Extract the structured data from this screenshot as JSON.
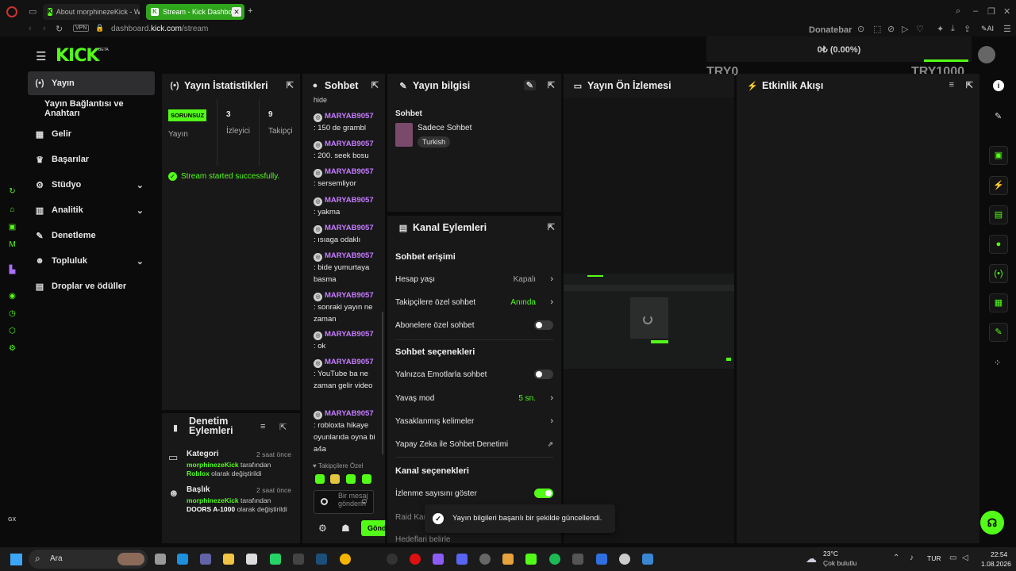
{
  "browser": {
    "tabs": [
      {
        "label": "About morphinezeKick - W",
        "active": false
      },
      {
        "label": "Stream - Kick Dashboa",
        "active": true
      }
    ],
    "new_tab": "+",
    "vpn": "VPN",
    "url_host": "dashboard.",
    "url_domain": "kick.com",
    "url_path": "/stream",
    "extension_label": "Donatebar",
    "ai_label": "AI"
  },
  "overlay": {
    "amount": "0₺ (0.00%)",
    "left_label": "TRY0",
    "right_label": "TRY1000"
  },
  "logo": "KICK",
  "logo_badge": "BETA",
  "sidebar": {
    "items": [
      {
        "label": "Yayın",
        "active": true,
        "icon": "broadcast-icon",
        "glyph": "(•)"
      },
      {
        "label": "Yayın Bağlantısı ve Anahtarı",
        "active": false,
        "icon": "",
        "glyph": ""
      },
      {
        "label": "Gelir",
        "active": false,
        "icon": "chart-icon",
        "glyph": "▦"
      },
      {
        "label": "Başarılar",
        "active": false,
        "icon": "trophy-icon",
        "glyph": "🏆"
      },
      {
        "label": "Stüdyo",
        "active": false,
        "icon": "studio-icon",
        "glyph": "⚙",
        "chevron": true
      },
      {
        "label": "Analitik",
        "active": false,
        "icon": "analytics-icon",
        "glyph": "▥",
        "chevron": true
      },
      {
        "label": "Denetleme",
        "active": false,
        "icon": "wrench-icon",
        "glyph": "🔧"
      },
      {
        "label": "Topluluk",
        "active": false,
        "icon": "community-icon",
        "glyph": "👥",
        "chevron": true
      },
      {
        "label": "Droplar ve ödüller",
        "active": false,
        "icon": "drops-icon",
        "glyph": "▤"
      }
    ]
  },
  "stats": {
    "title": "Yayın İstatistikleri",
    "status_badge": "SORUNSUZ",
    "status_caption": "Yayın",
    "viewers_value": "3",
    "viewers_label": "İzleyici",
    "followers_value": "9",
    "followers_label": "Takipçi",
    "notice": "Stream started successfully."
  },
  "moderation": {
    "title_line1": "Denetim",
    "title_line2": "Eylemleri",
    "items": [
      {
        "title": "Kategori",
        "time": "2 saat önce",
        "user": "morphinezeKick",
        "by": " tarafından",
        "value": "Roblox",
        "suffix": " olarak değiştirildi"
      },
      {
        "title": "Başlık",
        "time": "2 saat önce",
        "user": "morphinezeKick",
        "by": " tarafından",
        "value": "DOORS A-1000",
        "suffix": " olarak değiştirildi"
      }
    ]
  },
  "chat": {
    "title": "Sohbet",
    "top_cut": "hide",
    "messages": [
      {
        "user": "MARYAB9057",
        "text": ": 150 de grambl"
      },
      {
        "user": "MARYAB9057",
        "text": ": 200. seek bosu"
      },
      {
        "user": "MARYAB9057",
        "text": ": sersemliyor"
      },
      {
        "user": "MARYAB9057",
        "text": ": yakma"
      },
      {
        "user": "MARYAB9057",
        "text": ": ısıaga odaklı"
      },
      {
        "user": "MARYAB9057",
        "text": ": bide yumurtaya basma"
      },
      {
        "user": "MARYAB9057",
        "text": ": sonraki yayın ne zaman"
      },
      {
        "user": "MARYAB9057",
        "text": ": ok"
      },
      {
        "user": "MARYAB9057",
        "text": ": YouTube ba ne zaman gelir video"
      },
      {
        "user": "MARYAB9057",
        "text": ": robloxta hikaye oyunlarıda oyna bi a4a"
      }
    ],
    "followers_only": "Takipçilere Özel",
    "input_placeholder": "Bir mesaj gönderin",
    "send_label": "Gönder"
  },
  "stream_info": {
    "title": "Yayın bilgisi",
    "section": "Sohbet",
    "category": "Sadece Sohbet",
    "language": "Turkish"
  },
  "channel_actions": {
    "title": "Kanal Eylemleri",
    "chat_access": "Sohbet erişimi",
    "account_age": "Hesap yaşı",
    "account_age_value": "Kapalı",
    "followers_chat": "Takipçilere özel sohbet",
    "followers_chat_value": "Anında",
    "subs_chat": "Abonelere özel sohbet",
    "chat_options": "Sohbet seçenekleri",
    "emote_only": "Yalnızca Emotlarla sohbet",
    "slow_mode": "Yavaş mod",
    "slow_mode_value": "5 sn.",
    "banned_words": "Yasaklanmış kelimeler",
    "ai_moderation": "Yapay Zeka ile Sohbet Denetimi",
    "channel_options": "Kanal seçenekleri",
    "show_viewers": "İzlenme sayısını göster",
    "raid": "Raid Kan",
    "next_cut": "Hedeflari belirle"
  },
  "preview": {
    "title": "Yayın Ön İzlemesi"
  },
  "activity": {
    "title": "Etkinlik Akışı"
  },
  "toast": {
    "message": "Yayın bilgileri başarılı bir şekilde güncellendi."
  },
  "taskbar": {
    "search": "Ara",
    "weather_temp": "23°C",
    "weather_desc": "Çok bulutlu",
    "lang": "TUR",
    "time": "22:54",
    "date": "1.08.2026"
  },
  "rail_left_bottom": "GX",
  "colors": {
    "accent": "#53fc18",
    "chat_user": "#c67cff",
    "panel": "#181819",
    "bg": "#0b0b0c"
  }
}
